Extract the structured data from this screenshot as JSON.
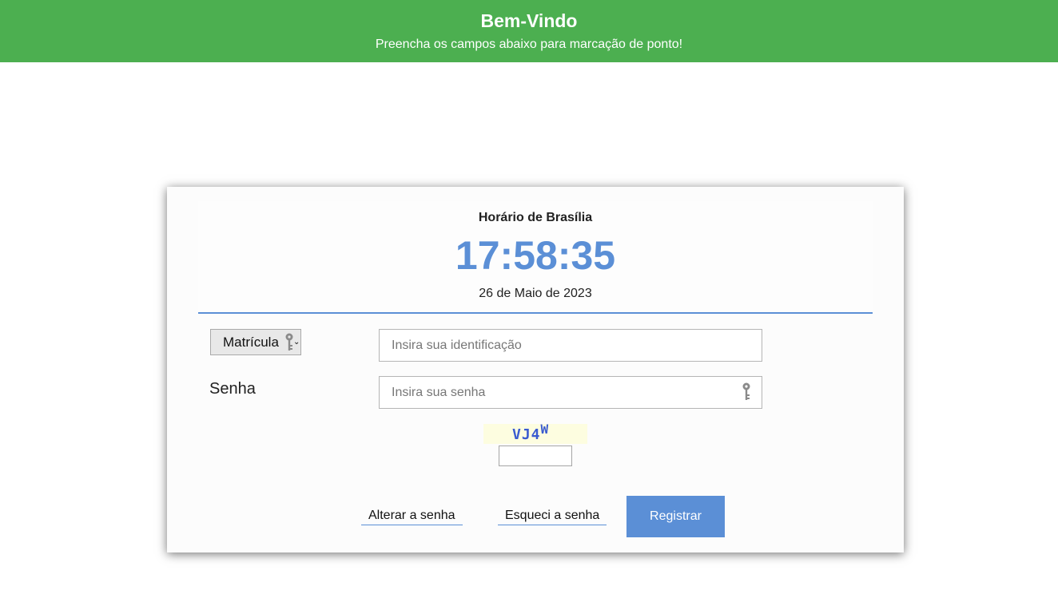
{
  "header": {
    "title": "Bem-Vindo",
    "subtitle": "Preencha os campos abaixo para marcação de ponto!",
    "background_color": "#4caf50"
  },
  "clock": {
    "label": "Horário de Brasília",
    "time": "17:58:35",
    "date": "26 de Maio de 2023",
    "accent_color": "#5b8fd6"
  },
  "form": {
    "id_type_select": {
      "selected": "Matrícula",
      "icon": "key-icon"
    },
    "id_input": {
      "placeholder": "Insira sua identificação",
      "value": ""
    },
    "password_label": "Senha",
    "password_input": {
      "placeholder": "Insira sua senha",
      "value": "",
      "icon": "key-icon"
    },
    "captcha": {
      "text_main": "VJ4",
      "text_raised": "W",
      "input_value": ""
    }
  },
  "actions": {
    "change_password": "Alterar a senha",
    "forgot_password": "Esqueci a senha",
    "register": "Registrar"
  }
}
